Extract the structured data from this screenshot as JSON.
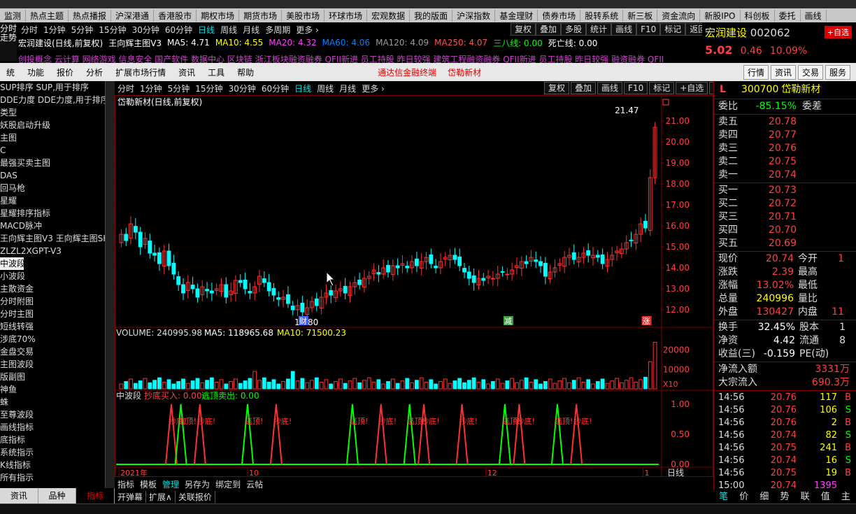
{
  "top_menu": [
    "监测",
    "热点主题",
    "热点播报",
    "沪深港通",
    "香港股市",
    "期权市场",
    "期货市场",
    "美股市场",
    "环球市场",
    "宏观数据",
    "我的版面",
    "沪深指数",
    "基金理财",
    "债券市场",
    "股转系统",
    "新三板",
    "资金流向",
    "新股IPO",
    "科创板",
    "委托",
    "画线"
  ],
  "bg_window": {
    "side_label": "分时走势",
    "tabs": [
      "分时",
      "1分钟",
      "5分钟",
      "15分钟",
      "30分钟",
      "60分钟",
      "日线",
      "周线",
      "月线",
      "多周期",
      "更多 ›"
    ],
    "active_tab": "日线",
    "right_buttons": [
      "复权",
      "叠加",
      "多股",
      "统计",
      "画线",
      "F10",
      "标记",
      "返回"
    ],
    "title": "宏润建设(日线,前复权)",
    "indicator": "王向辉主图V3",
    "ma": [
      {
        "label": "MA5: 4.71",
        "color": "#ffffff"
      },
      {
        "label": "MA10: 4.55",
        "color": "#ffff00"
      },
      {
        "label": "MA20: 4.32",
        "color": "#ff40ff"
      },
      {
        "label": "MA60: 4.06",
        "color": "#0080ff"
      },
      {
        "label": "MA120: 4.09",
        "color": "#9a9a9a"
      },
      {
        "label": "MA250: 4.07",
        "color": "#ff5050"
      },
      {
        "label": "三八线: 0.00",
        "color": "#00ff00"
      },
      {
        "label": "死亡线: 0.00",
        "color": "#ffffff"
      }
    ],
    "ticker": "创投概念 云计算 网络游戏 信息安全 国产软件 数据中心 区块链 浙江板块融资融券 QFII新进 员工持股 昨日较强 建筑工程融资融券 QFII新进 员工持股 昨日较强 融资融券 QFII",
    "stock_name": "宏润建设",
    "stock_code": "002062",
    "self_select": "+自选",
    "price": "5.02",
    "change": "0.46",
    "pct": "10.09%"
  },
  "menu2": {
    "items": [
      "统",
      "功能",
      "报价",
      "分析",
      "扩展市场行情",
      "资讯",
      "工具",
      "帮助"
    ],
    "promo": [
      "通达信金融终端",
      "岱勒新材"
    ],
    "right": [
      "行情",
      "资讯",
      "交易",
      "服务"
    ]
  },
  "sidebar": {
    "items": [
      "SUP排序 SUP,用于排序",
      "DDE力度 DDE力度,用于排序",
      "类型",
      "妖股启动升级",
      "主图",
      "C",
      "最强买卖主图",
      "DAS",
      "回马枪",
      "星耀",
      "星耀排序指标",
      "MACD脉冲",
      "王向辉主图V3 王向辉主图SHA",
      "ZLZL2XGPT-V3",
      "中波段",
      "小波段",
      "主散资金",
      "分时附图",
      "分时主图",
      "短线转强",
      "涉底70%",
      "金盘交易",
      "主图波段",
      "版副图",
      "神鱼",
      "蛛",
      "至尊波段",
      "画线指标",
      "底指标",
      "系统指示",
      "K线指标",
      "所有指示"
    ],
    "selected_index": 14,
    "tabs": [
      "资讯",
      "品种",
      "指标"
    ],
    "active_tab": "指标"
  },
  "chart_toolbar": {
    "tabs": [
      "分时",
      "1分钟",
      "5分钟",
      "15分钟",
      "30分钟",
      "60分钟",
      "日线",
      "周线",
      "月线",
      "更多 ›"
    ],
    "active": "日线",
    "right": [
      "复权",
      "叠加",
      "画线",
      "F10",
      "标记",
      "+自选",
      "返回"
    ]
  },
  "main_chart": {
    "title": "岱勒新材(日线,前复权)",
    "high_label": "21.47",
    "low_label": "11.80",
    "yticks": [
      "21.00",
      "20.00",
      "19.00",
      "18.00",
      "17.00",
      "16.00",
      "15.00",
      "14.00",
      "13.00",
      "12.00"
    ],
    "markers": [
      {
        "text": "财",
        "color": "#4060ff"
      },
      {
        "text": "减",
        "color": "#40a040"
      },
      {
        "text": "涨",
        "color": "#e03030"
      }
    ]
  },
  "volume_panel": {
    "label": "VOLUME: 240995.98",
    "ma5": "MA5: 118965.68",
    "ma10": "MA10: 71500.23",
    "yticks": [
      "20000",
      "10000"
    ],
    "unit": "X10"
  },
  "zbd_panel": {
    "label": "中波段",
    "buy": "抄底买入: 0.00",
    "sell": "逃顶卖出: 0.00",
    "yticks": [
      "1.00",
      "0.50",
      "0.00"
    ],
    "top_text": "逃顶!",
    "bottom_text": "抄底!",
    "period": "日线"
  },
  "xaxis": {
    "labels": [
      "2021年",
      "10",
      "12",
      "1"
    ]
  },
  "bottom_tabs": [
    "指标",
    "模板",
    "管理",
    "另存为",
    "绑定到",
    "云帖"
  ],
  "bottom_active": "管理",
  "bottom_tabs2": [
    "开弹幕",
    "扩展∧",
    "关联报价"
  ],
  "right_panel": {
    "code": "300700",
    "name": "岱勒新材",
    "weibi_label": "委比",
    "weibi_val": "-85.15%",
    "weicha_label": "委差",
    "sells": [
      {
        "label": "卖五",
        "price": "20.78"
      },
      {
        "label": "卖四",
        "price": "20.77"
      },
      {
        "label": "卖三",
        "price": "20.76"
      },
      {
        "label": "卖二",
        "price": "20.75"
      },
      {
        "label": "卖一",
        "price": "20.74"
      }
    ],
    "buys": [
      {
        "label": "买一",
        "price": "20.73"
      },
      {
        "label": "买二",
        "price": "20.72"
      },
      {
        "label": "买三",
        "price": "20.71"
      },
      {
        "label": "买四",
        "price": "20.70"
      },
      {
        "label": "买五",
        "price": "20.69"
      }
    ],
    "stats": [
      {
        "l": "现价",
        "v": "20.74",
        "l2": "今开",
        "v2": "1",
        "color": "#ff4040"
      },
      {
        "l": "涨跌",
        "v": "2.39",
        "l2": "最高",
        "v2": "",
        "color": "#ff4040"
      },
      {
        "l": "涨幅",
        "v": "13.02%",
        "l2": "最低",
        "v2": "",
        "color": "#ff4040"
      },
      {
        "l": "总量",
        "v": "240996",
        "l2": "量比",
        "v2": "",
        "color": "#ffff00"
      },
      {
        "l": "外盘",
        "v": "130427",
        "l2": "内盘",
        "v2": "11",
        "color": "#ff4040"
      }
    ],
    "stats2": [
      {
        "l": "换手",
        "v": "32.45%",
        "l2": "股本",
        "v2": "1",
        "color": "#ffffff"
      },
      {
        "l": "净资",
        "v": "4.42",
        "l2": "流通",
        "v2": "8",
        "color": "#ffffff"
      },
      {
        "l": "收益(三)",
        "v": "-0.159",
        "l2": "PE(动)",
        "v2": "",
        "color": "#ffffff"
      }
    ],
    "flows": [
      {
        "l": "净流入额",
        "v": "3331万"
      },
      {
        "l": "大宗流入",
        "v": "690.3万"
      }
    ],
    "ticks": [
      {
        "t": "14:56",
        "p": "20.76",
        "q": "117",
        "b": "B"
      },
      {
        "t": "14:56",
        "p": "20.76",
        "q": "106",
        "b": "S"
      },
      {
        "t": "14:56",
        "p": "20.76",
        "q": "2",
        "b": "B"
      },
      {
        "t": "14:56",
        "p": "20.74",
        "q": "82",
        "b": "S"
      },
      {
        "t": "14:56",
        "p": "20.75",
        "q": "241",
        "b": "B"
      },
      {
        "t": "14:56",
        "p": "20.74",
        "q": "16",
        "b": "S"
      },
      {
        "t": "14:56",
        "p": "20.75",
        "q": "19",
        "b": "B"
      },
      {
        "t": "15:00",
        "p": "20.74",
        "q": "1395",
        "b": ""
      }
    ],
    "tabs": [
      "笔",
      "价",
      "细",
      "势",
      "联",
      "值",
      "主"
    ]
  },
  "colors": {
    "up": "#ff3232",
    "down": "#00ffff",
    "bg": "#000000"
  }
}
